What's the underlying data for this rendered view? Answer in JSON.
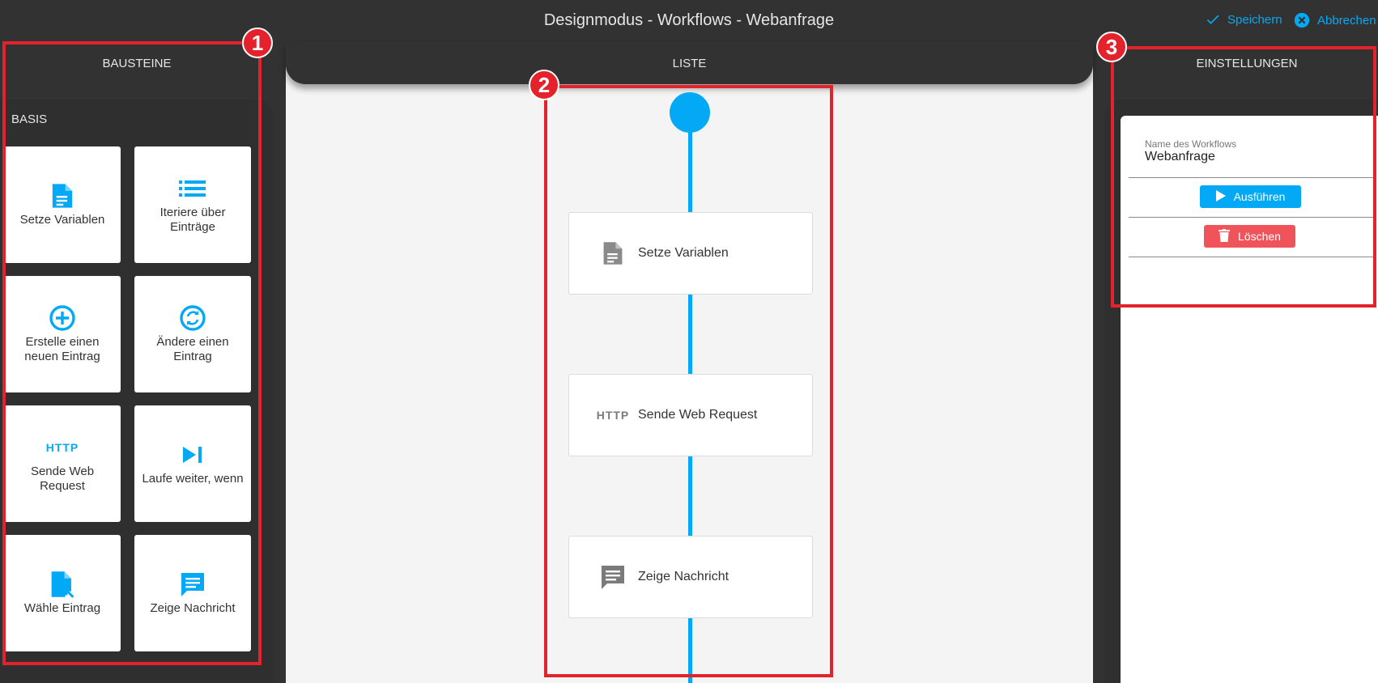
{
  "header": {
    "title": "Designmodus - Workflows - Webanfrage",
    "save_label": "Speichern",
    "cancel_label": "Abbrechen"
  },
  "tabs": {
    "left": "BAUSTEINE",
    "middle": "LISTE",
    "right": "EINSTELLUNGEN"
  },
  "palette": {
    "section": "BASIS",
    "tiles": [
      {
        "label": "Setze Variablen",
        "icon": "document-icon"
      },
      {
        "label": "Iteriere über Einträge",
        "icon": "list-icon"
      },
      {
        "label": "Erstelle einen neuen Eintrag",
        "icon": "plus-circle-icon"
      },
      {
        "label": "Ändere einen Eintrag",
        "icon": "sync-circle-icon"
      },
      {
        "label": "Sende Web Request",
        "icon": "http-icon",
        "icon_text": "HTTP"
      },
      {
        "label": "Laufe weiter, wenn",
        "icon": "skip-next-icon"
      },
      {
        "label": "Wähle Eintrag",
        "icon": "file-select-icon"
      },
      {
        "label": "Zeige Nachricht",
        "icon": "message-icon"
      }
    ]
  },
  "workflow": {
    "steps": [
      {
        "label": "Setze Variablen",
        "icon": "document-icon"
      },
      {
        "label": "Sende Web Request",
        "icon": "http-icon",
        "icon_text": "HTTP"
      },
      {
        "label": "Zeige Nachricht",
        "icon": "message-icon"
      }
    ]
  },
  "settings": {
    "name_label": "Name des Workflows",
    "name_value": "Webanfrage",
    "run_label": "Ausführen",
    "delete_label": "Löschen"
  },
  "annotations": [
    "1",
    "2",
    "3"
  ],
  "colors": {
    "accent": "#03a9f4",
    "danger": "#f0545a",
    "highlight": "#e3222b",
    "panel": "#2f2f2f",
    "canvas": "#f4f4f4"
  }
}
